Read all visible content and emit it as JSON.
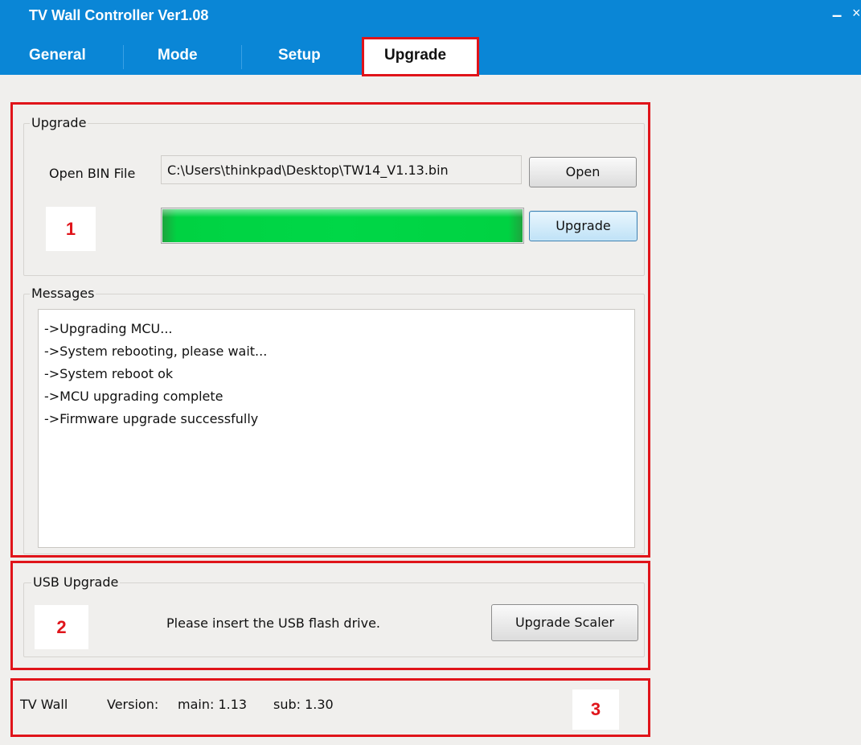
{
  "window": {
    "title": "TV Wall Controller Ver1.08",
    "minimize_glyph": "–",
    "close_glyph": "×"
  },
  "tabs": [
    {
      "label": "General",
      "active": false
    },
    {
      "label": "Mode",
      "active": false
    },
    {
      "label": "Setup",
      "active": false
    },
    {
      "label": "Upgrade",
      "active": true
    }
  ],
  "upgrade": {
    "group_title": "Upgrade",
    "open_bin_label": "Open BIN File",
    "file_path": "C:\\Users\\thinkpad\\Desktop\\TW14_V1.13.bin",
    "open_button": "Open",
    "upgrade_button": "Upgrade",
    "progress_fraction": 1.0
  },
  "messages": {
    "group_title": "Messages",
    "lines": [
      "->Upgrading MCU...",
      "->System rebooting, please wait...",
      "->System reboot ok",
      "->MCU upgrading complete",
      "->Firmware upgrade successfully"
    ]
  },
  "usb": {
    "group_title": "USB Upgrade",
    "prompt": "Please insert the USB flash drive.",
    "button": "Upgrade Scaler"
  },
  "status": {
    "device": "TV Wall",
    "version_label": "Version:",
    "main": "main: 1.13",
    "sub": "sub: 1.30"
  },
  "annotations": {
    "marker_1": "1",
    "marker_2": "2",
    "marker_3": "3"
  },
  "colors": {
    "header": "#0a86d6",
    "highlight": "#e0141a",
    "progress": "#00d747",
    "panel": "#f0efed"
  }
}
